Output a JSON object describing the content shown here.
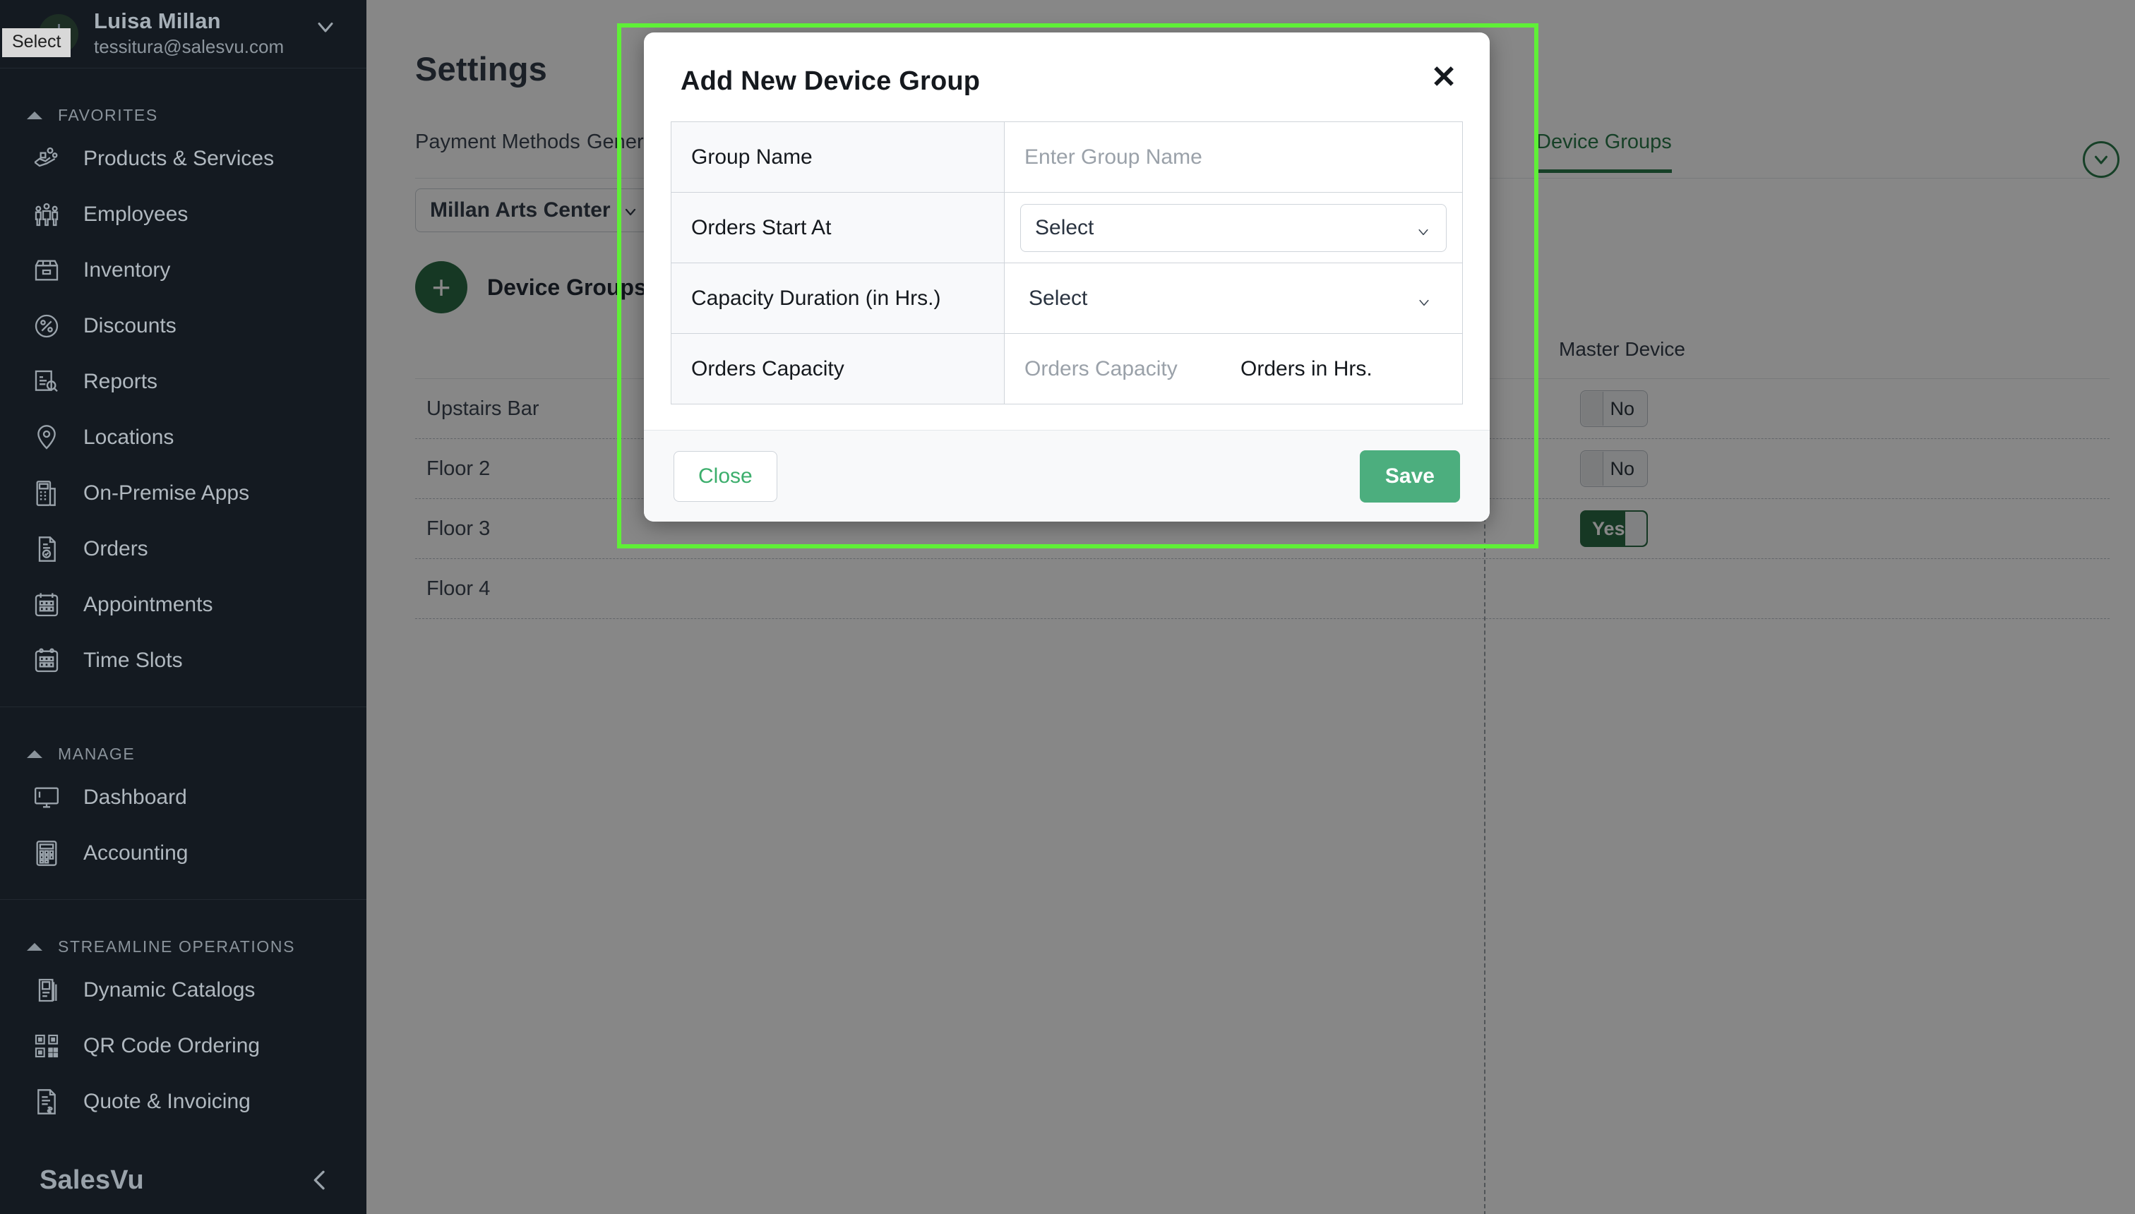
{
  "sidebar": {
    "user": {
      "name": "Luisa Millan",
      "email": "tessitura@salesvu.com",
      "chevron_icon": "chevron-down-icon"
    },
    "select_badge": "Select",
    "sections": [
      {
        "label": "FAVORITES",
        "items": [
          {
            "label": "Products & Services",
            "icon": "products-services-icon"
          },
          {
            "label": "Employees",
            "icon": "employees-icon"
          },
          {
            "label": "Inventory",
            "icon": "inventory-box-icon"
          },
          {
            "label": "Discounts",
            "icon": "discount-percent-icon"
          },
          {
            "label": "Reports",
            "icon": "reports-magnifier-icon"
          },
          {
            "label": "Locations",
            "icon": "location-pin-icon"
          },
          {
            "label": "On-Premise Apps",
            "icon": "pos-terminal-icon"
          },
          {
            "label": "Orders",
            "icon": "orders-document-icon"
          },
          {
            "label": "Appointments",
            "icon": "calendar-icon"
          },
          {
            "label": "Time Slots",
            "icon": "calendar-clock-icon"
          }
        ]
      },
      {
        "label": "MANAGE",
        "items": [
          {
            "label": "Dashboard",
            "icon": "monitor-icon"
          },
          {
            "label": "Accounting",
            "icon": "calculator-icon"
          }
        ]
      },
      {
        "label": "STREAMLINE OPERATIONS",
        "items": [
          {
            "label": "Dynamic Catalogs",
            "icon": "catalog-book-icon"
          },
          {
            "label": "QR Code Ordering",
            "icon": "qr-code-icon"
          },
          {
            "label": "Quote & Invoicing",
            "icon": "invoice-document-icon"
          }
        ]
      }
    ],
    "footer": {
      "logo": "SalesVu",
      "collapse_icon": "chevron-left-icon"
    }
  },
  "page": {
    "title": "Settings",
    "tabs": [
      {
        "label": "Payment Methods",
        "active": false
      },
      {
        "label": "General",
        "active": false
      },
      {
        "label": "Device Groups",
        "active": true
      }
    ],
    "location_selector": {
      "value": "Millan Arts Center",
      "chevron_icon": "chevron-down-icon"
    },
    "collapse_circle_icon": "chevron-down-circle-icon",
    "device_groups": {
      "add_icon": "plus-icon",
      "title": "Device Groups",
      "columns": [
        "Master Device"
      ],
      "rows": [
        {
          "name": "Upstairs Bar",
          "master_device": "No",
          "master_device_on": false
        },
        {
          "name": "Floor 2",
          "master_device": "No",
          "master_device_on": false
        },
        {
          "name": "Floor 3",
          "master_device": "Yes",
          "master_device_on": true
        },
        {
          "name": "Floor 4",
          "master_device": "",
          "master_device_on": false
        }
      ]
    }
  },
  "modal": {
    "title": "Add New Device Group",
    "close_icon": "close-x-icon",
    "fields": [
      {
        "label": "Group Name",
        "type": "text",
        "value": "",
        "placeholder": "Enter Group Name"
      },
      {
        "label": "Orders Start At",
        "type": "select-boxed",
        "value": "Select",
        "arrow_icon": "chevron-down-icon"
      },
      {
        "label": "Capacity Duration (in Hrs.)",
        "type": "select-plain",
        "value": "Select",
        "arrow_icon": "chevron-down-icon"
      },
      {
        "label": "Orders Capacity",
        "type": "capacity",
        "value": "",
        "placeholder": "Orders Capacity",
        "suffix": "Orders in Hrs."
      }
    ],
    "buttons": {
      "close": "Close",
      "save": "Save"
    }
  },
  "colors": {
    "sidebar_bg": "#141a21",
    "accent_green": "#2b7a4b",
    "save_green": "#4cae7e",
    "highlight_green": "#5ff037",
    "scrim": "rgba(0,0,0,0.47)"
  }
}
